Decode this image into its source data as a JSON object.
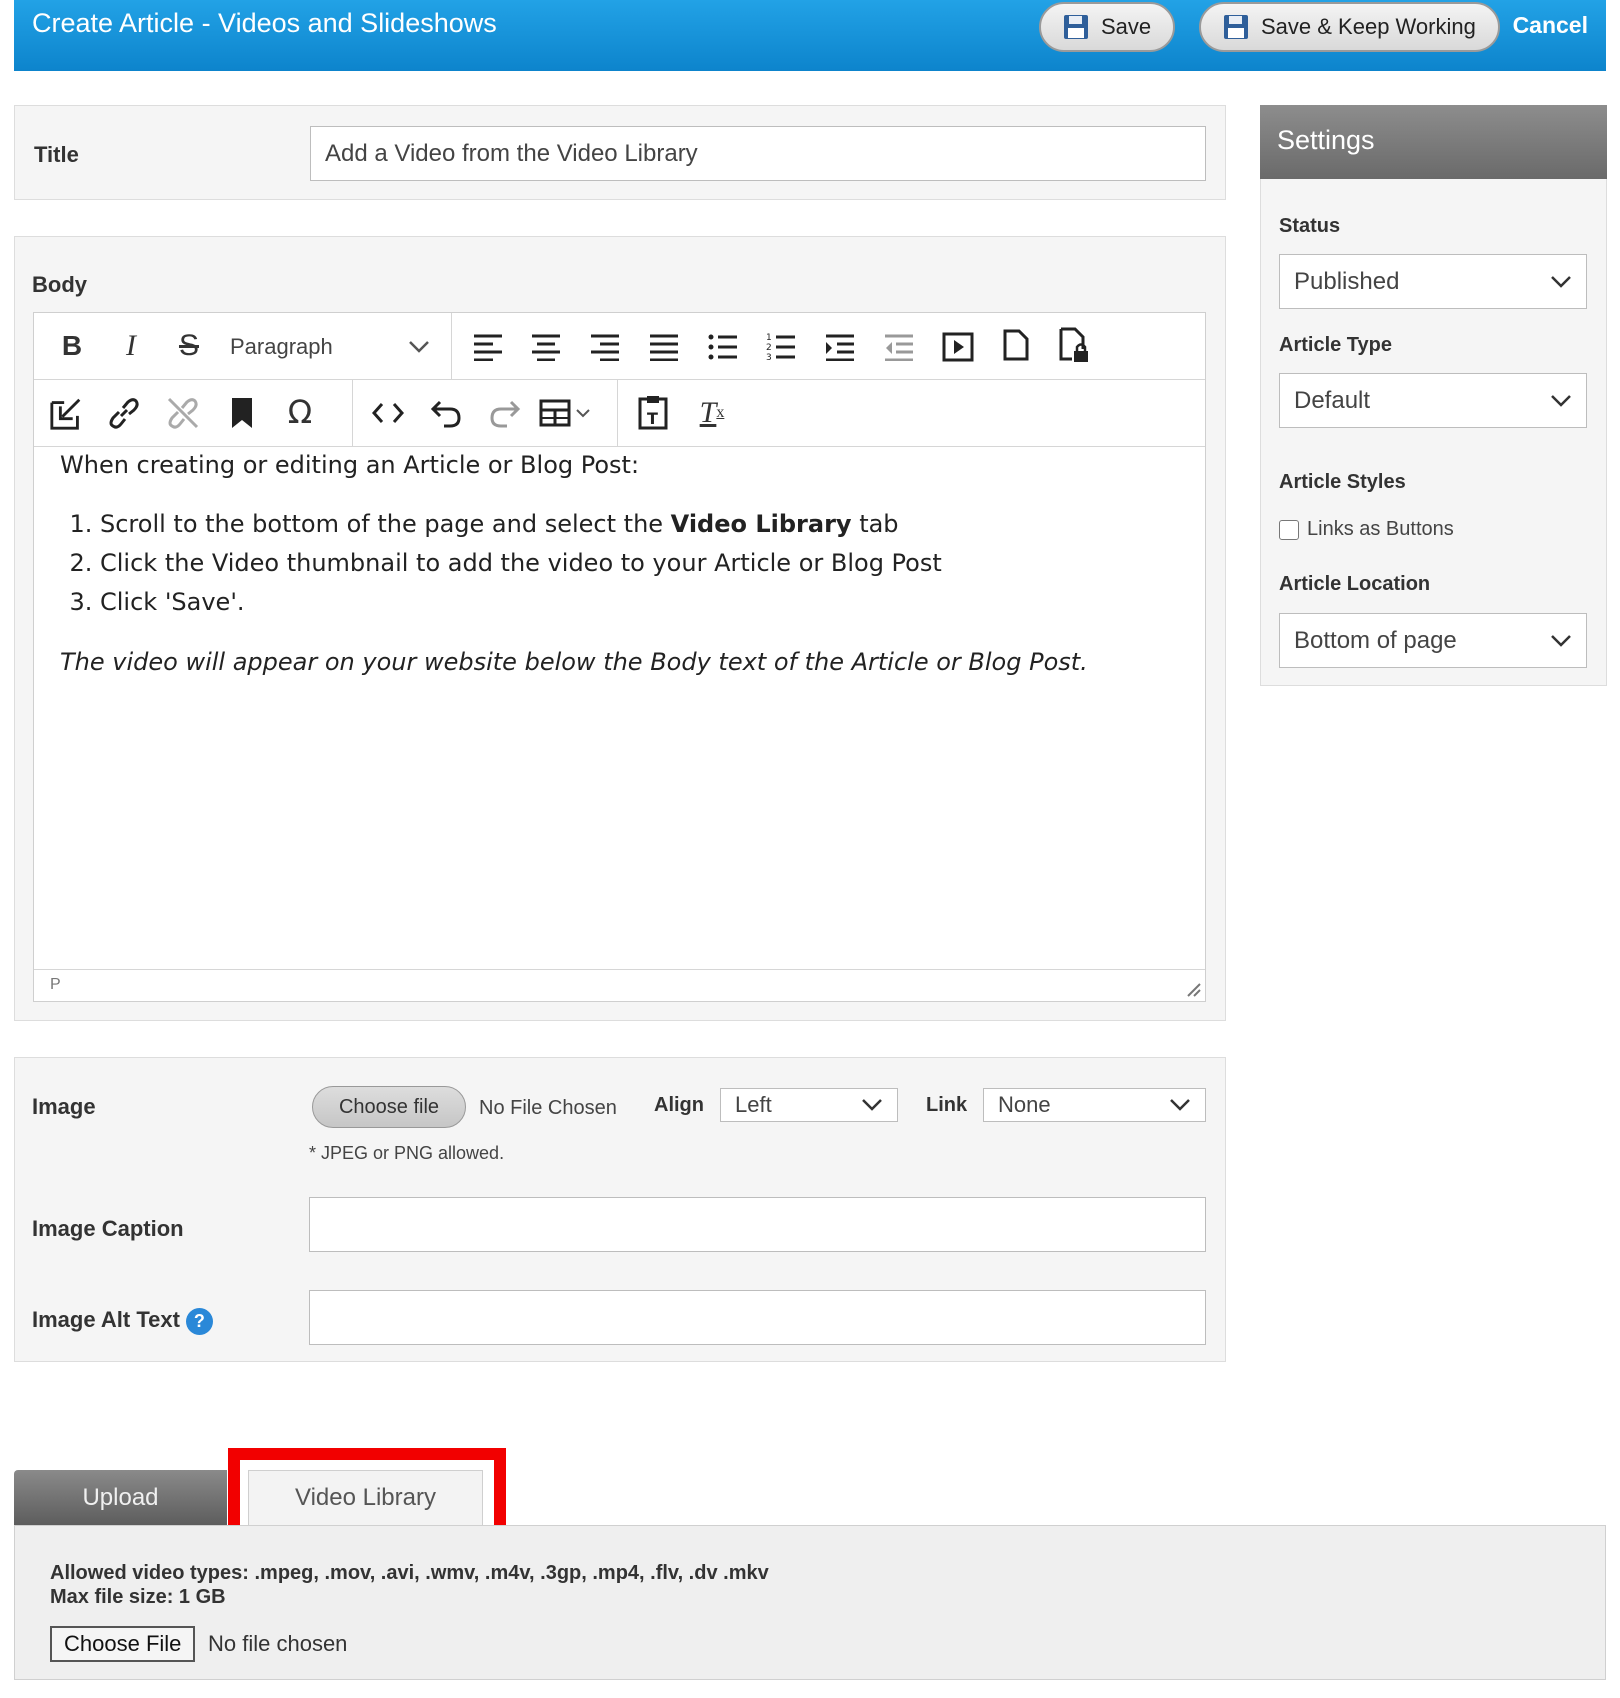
{
  "header": {
    "title": "Create Article - Videos and Slideshows",
    "save_label": "Save",
    "save_keep_label": "Save & Keep Working",
    "cancel_label": "Cancel",
    "background_color": "#1a96dc"
  },
  "title_field": {
    "label": "Title",
    "value": "Add a Video from the Video Library"
  },
  "body": {
    "label": "Body",
    "format_select": "Paragraph",
    "toolbar_row1_icons": [
      "bold-icon",
      "italic-icon",
      "strikethrough-icon",
      "align-left-icon",
      "align-center-icon",
      "align-right-icon",
      "align-justify-icon",
      "bullet-list-icon",
      "numbered-list-icon",
      "indent-icon",
      "outdent-icon",
      "media-icon",
      "page-icon",
      "protected-page-icon"
    ],
    "toolbar_row2_icons": [
      "insert-icon",
      "link-icon",
      "unlink-icon",
      "bookmark-icon",
      "special-char-icon",
      "source-code-icon",
      "undo-icon",
      "redo-icon",
      "table-icon",
      "paste-text-icon",
      "clear-format-icon"
    ],
    "intro": "When creating or editing an Article or Blog Post:",
    "steps": [
      {
        "before": "Scroll to the bottom of the page and select the ",
        "bold": "Video Library",
        "after": " tab"
      },
      {
        "before": "Click the Video thumbnail to add the video to your Article or Blog Post",
        "bold": "",
        "after": ""
      },
      {
        "before": "Click 'Save'.",
        "bold": "",
        "after": ""
      }
    ],
    "note": "The video will appear on your website below the Body text of the Article or Blog Post.",
    "status_path": "P"
  },
  "image": {
    "label": "Image",
    "choose_file_label": "Choose file",
    "no_file_text": "No File Chosen",
    "align_label": "Align",
    "align_value": "Left",
    "link_label": "Link",
    "link_value": "None",
    "note": "* JPEG or PNG allowed.",
    "caption_label": "Image Caption",
    "caption_value": "",
    "alt_label": "Image Alt Text",
    "help_glyph": "?"
  },
  "settings": {
    "title": "Settings",
    "status_label": "Status",
    "status_value": "Published",
    "article_type_label": "Article Type",
    "article_type_value": "Default",
    "article_styles_label": "Article Styles",
    "links_as_buttons_label": "Links as Buttons",
    "links_as_buttons_checked": false,
    "article_location_label": "Article Location",
    "article_location_value": "Bottom of page"
  },
  "tabs": {
    "upload_label": "Upload",
    "video_library_label": "Video Library",
    "highlight_color": "#f20000"
  },
  "upload": {
    "allowed_types": "Allowed video types: .mpeg, .mov, .avi, .wmv, .m4v, .3gp, .mp4, .flv, .dv .mkv",
    "max_size": "Max file size: 1 GB",
    "choose_file_label": "Choose File",
    "no_file_text": "No file chosen"
  }
}
